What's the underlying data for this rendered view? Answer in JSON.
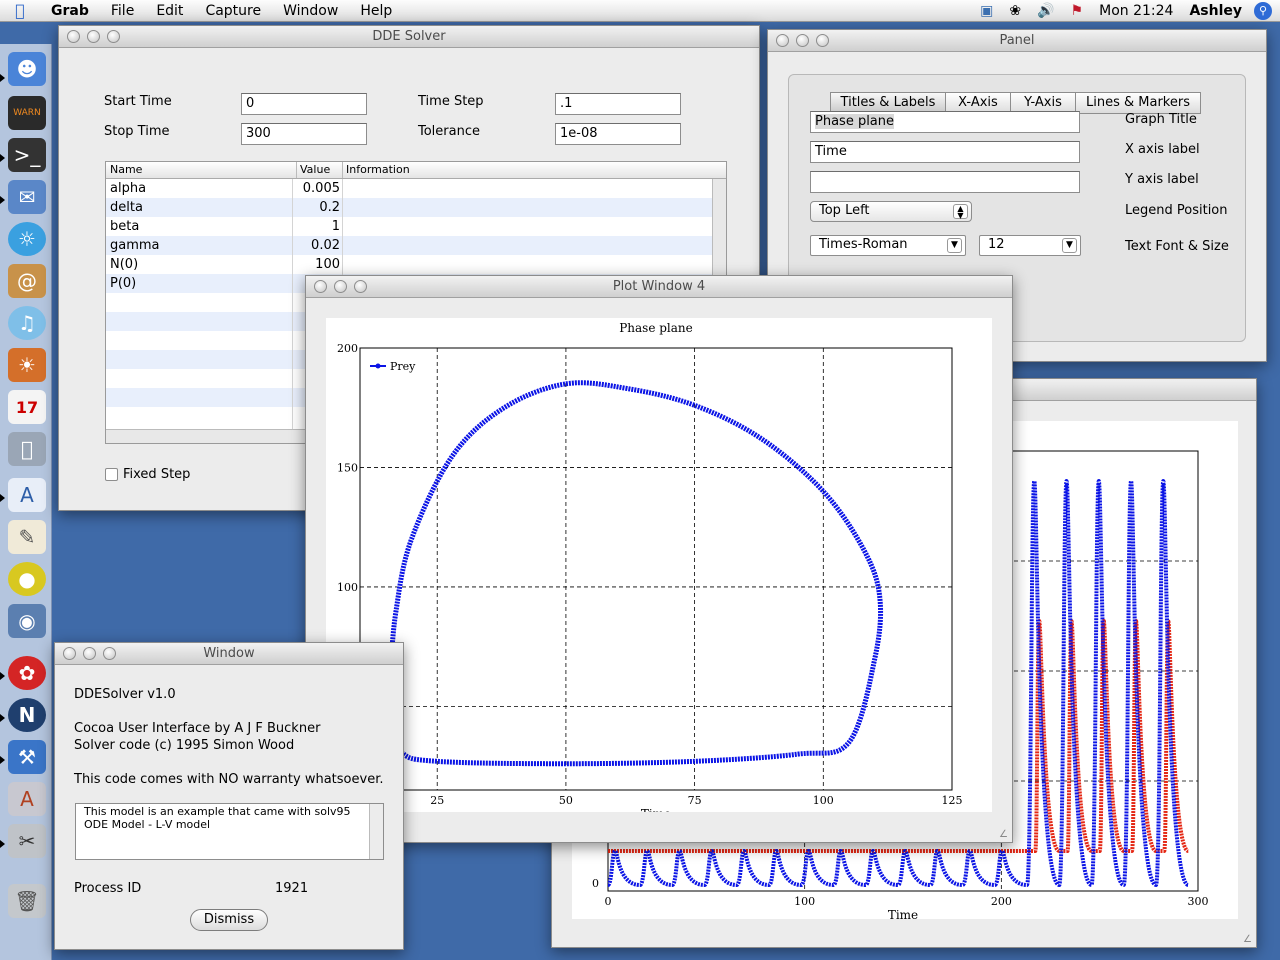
{
  "menubar": {
    "app": "Grab",
    "items": [
      "File",
      "Edit",
      "Capture",
      "Window",
      "Help"
    ],
    "clock": "Mon 21:24",
    "user": "Ashley"
  },
  "dde_window": {
    "title": "DDE Solver",
    "start_time_label": "Start Time",
    "start_time": "0",
    "stop_time_label": "Stop Time",
    "stop_time": "300",
    "time_step_label": "Time Step",
    "time_step": ".1",
    "tolerance_label": "Tolerance",
    "tolerance": "1e-08",
    "table_headers": [
      "Name",
      "Value",
      "Information"
    ],
    "params": [
      {
        "name": "alpha",
        "value": "0.005"
      },
      {
        "name": "delta",
        "value": "0.2"
      },
      {
        "name": "beta",
        "value": "1"
      },
      {
        "name": "gamma",
        "value": "0.02"
      },
      {
        "name": "N(0)",
        "value": "100"
      },
      {
        "name": "P(0)",
        "value": ""
      }
    ],
    "fixed_step_label": "Fixed Step"
  },
  "panel_window": {
    "title": "Panel",
    "tabs": [
      "Titles & Labels",
      "X-Axis",
      "Y-Axis",
      "Lines & Markers"
    ],
    "graph_title_value": "Phase plane",
    "graph_title_label": "Graph Title",
    "x_label_value": "Time",
    "x_label_label": "X axis label",
    "y_label_value": "",
    "y_label_label": "Y axis label",
    "legend_value": "Top Left",
    "legend_label": "Legend Position",
    "font_value": "Times-Roman",
    "size_value": "12",
    "font_label": "Text Font & Size"
  },
  "plot4_window": {
    "title": "Plot Window 4",
    "chart_data": {
      "type": "line",
      "title": "Phase plane",
      "xlabel": "Time",
      "ylabel": "",
      "xlim": [
        10,
        125
      ],
      "ylim": [
        15,
        200
      ],
      "x_ticks": [
        "25",
        "50",
        "75",
        "100",
        "125"
      ],
      "y_ticks": [
        "100",
        "150",
        "200"
      ],
      "legend": "Prey",
      "legend_position": "top-left",
      "grid": true,
      "series": [
        {
          "name": "Prey",
          "color": "#0b14e6",
          "points": [
            [
              50,
              185
            ],
            [
              62,
              183
            ],
            [
              75,
              176
            ],
            [
              88,
              162
            ],
            [
              100,
              140
            ],
            [
              108,
              115
            ],
            [
              111,
              95
            ],
            [
              110,
              70
            ],
            [
              105,
              35
            ],
            [
              95,
              30
            ],
            [
              75,
              27
            ],
            [
              50,
              26
            ],
            [
              25,
              27
            ],
            [
              18,
              31
            ],
            [
              16,
              45
            ],
            [
              16,
              65
            ],
            [
              17,
              90
            ],
            [
              20,
              120
            ],
            [
              28,
              155
            ],
            [
              38,
              175
            ],
            [
              50,
              185
            ]
          ]
        }
      ]
    }
  },
  "plot_back_window": {
    "chart_data": {
      "type": "line",
      "xlabel": "Time",
      "ylabel": "",
      "xlim": [
        0,
        300
      ],
      "x_ticks": [
        "0",
        "100",
        "200",
        "300"
      ],
      "y_ticks": [
        "0"
      ],
      "series": [
        {
          "name": "",
          "color": "#0b14e6"
        },
        {
          "name": "",
          "color": "#e42613"
        }
      ]
    }
  },
  "about_window": {
    "title": "Window",
    "version": "DDESolver v1.0",
    "credits1": "Cocoa User Interface by A J F Buckner",
    "credits2": "Solver code (c) 1995 Simon Wood",
    "warranty": "This code comes with NO warranty whatsoever.",
    "note_line1": "This model is an example that came with solv95",
    "note_line2": "ODE Model - L-V model",
    "pid_label": "Process ID",
    "pid": "1921",
    "dismiss": "Dismiss"
  }
}
